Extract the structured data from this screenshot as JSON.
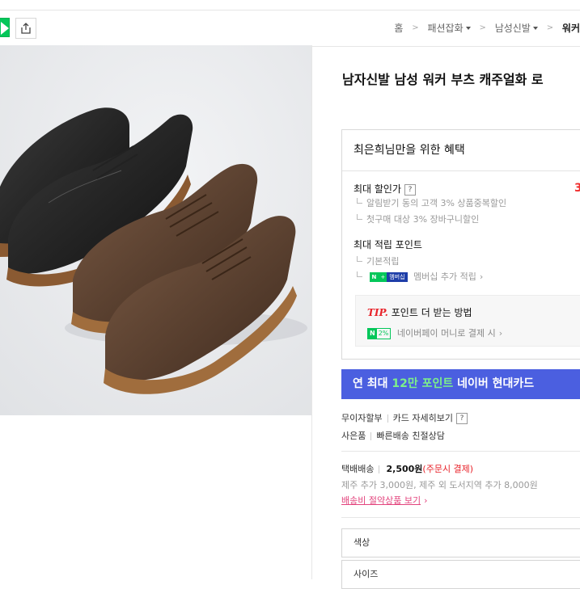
{
  "topbar": {
    "naver_icon": "naver-green-n-icon",
    "share_icon": "share-icon",
    "breadcrumb": [
      {
        "label": "홈",
        "dropdown": false
      },
      {
        "label": "패션잡화",
        "dropdown": true
      },
      {
        "label": "남성신발",
        "dropdown": true
      },
      {
        "label": "워커",
        "dropdown": false
      }
    ]
  },
  "product": {
    "title": "남자신발 남성 워커 부츠 캐주얼화 로"
  },
  "benefit": {
    "heading": "최은희님만을 위한 혜택",
    "max_discount_label": "최대 할인가",
    "max_discount_value": "3",
    "discount_items": [
      "알림받기 동의 고객 3% 상품중복할인",
      "첫구매 대상 3% 장바구니할인"
    ],
    "max_point_label": "최대 적립 포인트",
    "point_items": [
      "기본적립"
    ],
    "membership_badge_n": "N",
    "membership_badge_plus": "+",
    "membership_badge_text": "멤버십",
    "membership_link": "멤버십 추가 적립",
    "tip_label": "TIP.",
    "tip_text": "포인트 더 받는 방법",
    "tip_expand": "+",
    "npay_badge_n": "N",
    "npay_badge_pct": "2%",
    "npay_link": "네이버페이 머니로 결제 시"
  },
  "card_banner": {
    "prefix": "연 최대 ",
    "highlight": "12만 포인트",
    "suffix": " 네이버 현대카드"
  },
  "payment": {
    "installment": "무이자할부",
    "card_detail": "카드 자세히보기",
    "gift": "사은품",
    "fast_shipping": "빠른배송 친절상담"
  },
  "shipping": {
    "label": "택배배송",
    "price": "2,500원",
    "condition": "(주문시 결제)",
    "extra": "제주 추가 3,000원, 제주 외 도서지역 추가 8,000원",
    "saving_link": "배송비 절약상품 보기"
  },
  "options": {
    "color_placeholder": "색상",
    "size_placeholder": "사이즈"
  },
  "colors": {
    "naver_green": "#03c75a",
    "banner_blue": "#4b5fe0",
    "highlight_green": "#7df08a",
    "price_red": "#f02d2d",
    "link_pink": "#e3457e"
  }
}
